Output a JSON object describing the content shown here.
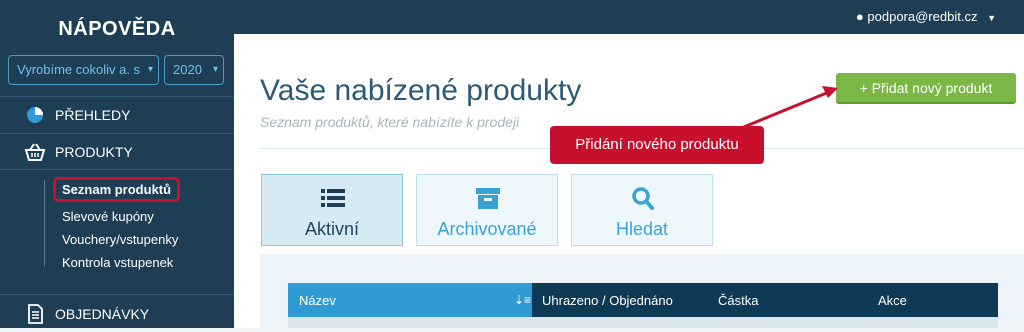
{
  "sidebar": {
    "brand": "NÁPOVĚDA",
    "company_select": "Vyrobíme cokoliv a. s",
    "year_select": "2020",
    "nav": {
      "overview": "PŘEHLEDY",
      "products": "PRODUKTY",
      "orders": "OBJEDNÁVKY"
    },
    "sub_items": [
      "Seznam produktů",
      "Slevové kupóny",
      "Vouchery/vstupenky",
      "Kontrola vstupenek"
    ]
  },
  "topbar": {
    "user_email": "podpora@redbit.cz"
  },
  "main": {
    "title": "Vaše nabízené produkty",
    "subtitle": "Seznam produktů, které nabízíte k prodeji",
    "add_button": "+ Přidat nový produkt",
    "callout": "Přidání nového produktu",
    "tabs": [
      {
        "label": "Aktivní",
        "icon": "list-icon"
      },
      {
        "label": "Archivované",
        "icon": "archive-icon"
      },
      {
        "label": "Hledat",
        "icon": "search-icon"
      }
    ],
    "table_headers": [
      "Název",
      "Uhrazeno / Objednáno",
      "Částka",
      "Akce"
    ]
  },
  "colors": {
    "sidebar_bg": "#1e3e55",
    "accent_blue": "#2f9bd4",
    "add_green": "#7ab744",
    "callout_red": "#c8102e"
  }
}
